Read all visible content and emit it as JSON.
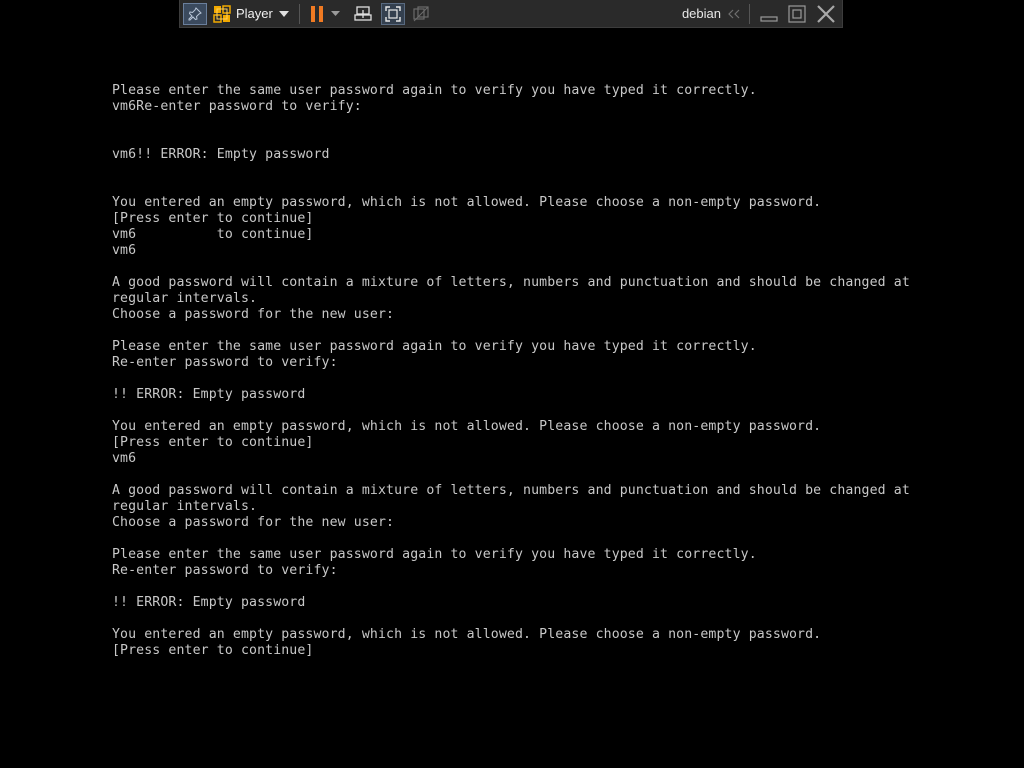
{
  "toolbar": {
    "player_label": "Player",
    "vm_name": "debian",
    "icons": {
      "pin": "pin-icon",
      "player_logo": "vmware-logo-icon",
      "pause": "pause-icon",
      "send_keys": "ctrl-alt-del-icon",
      "fullscreen": "fullscreen-icon",
      "unity": "unity-icon",
      "back": "double-chevron-left-icon",
      "minimize": "minimize-icon",
      "restore": "restore-icon",
      "close": "close-icon"
    },
    "colors": {
      "pause_accent": "#f07a22",
      "logo_accent": "#f2a900",
      "background": "#2a2a2a"
    }
  },
  "console": {
    "lines": [
      "Please enter the same user password again to verify you have typed it correctly.",
      "vm6Re-enter password to verify:",
      "",
      "",
      "vm6!! ERROR: Empty password",
      "",
      "",
      "You entered an empty password, which is not allowed. Please choose a non-empty password.",
      "[Press enter to continue]",
      "vm6          to continue]",
      "vm6",
      "",
      "A good password will contain a mixture of letters, numbers and punctuation and should be changed at",
      "regular intervals.",
      "Choose a password for the new user:",
      "",
      "Please enter the same user password again to verify you have typed it correctly.",
      "Re-enter password to verify:",
      "",
      "!! ERROR: Empty password",
      "",
      "You entered an empty password, which is not allowed. Please choose a non-empty password.",
      "[Press enter to continue]",
      "vm6",
      "",
      "A good password will contain a mixture of letters, numbers and punctuation and should be changed at",
      "regular intervals.",
      "Choose a password for the new user:",
      "",
      "Please enter the same user password again to verify you have typed it correctly.",
      "Re-enter password to verify:",
      "",
      "!! ERROR: Empty password",
      "",
      "You entered an empty password, which is not allowed. Please choose a non-empty password.",
      "[Press enter to continue]"
    ],
    "colors": {
      "text": "#c8c8c8",
      "background": "#000000"
    }
  }
}
